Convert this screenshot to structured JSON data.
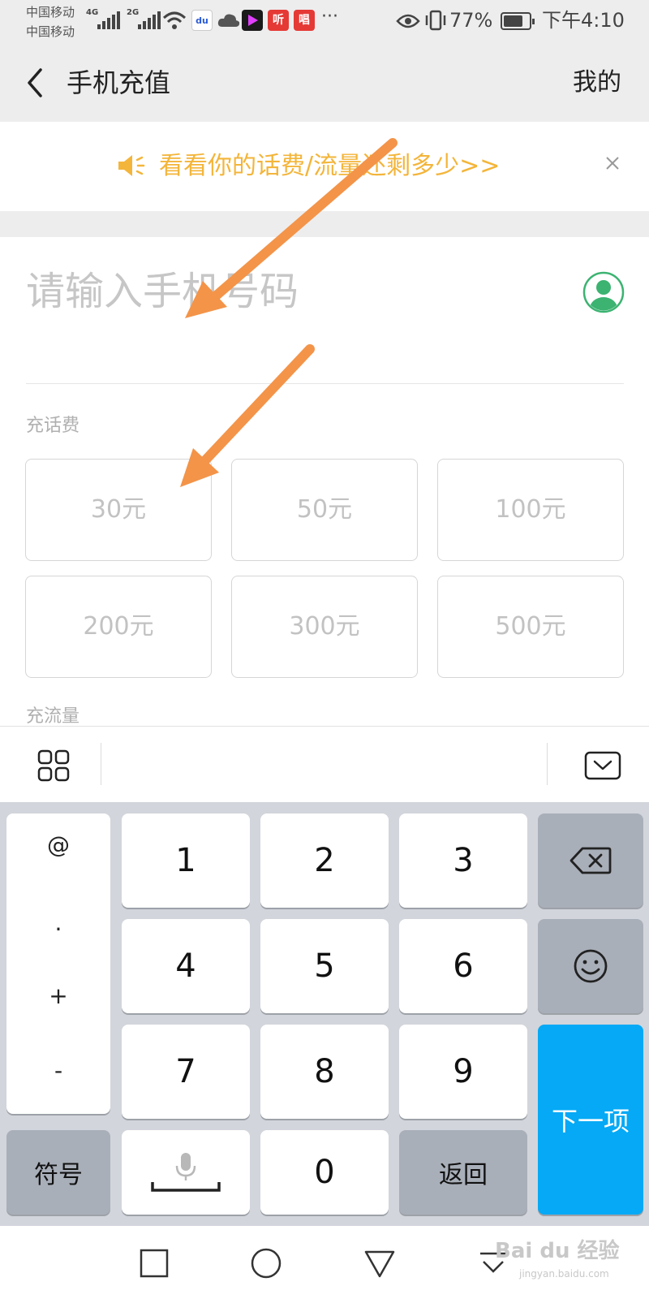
{
  "status_bar": {
    "carrier1": "中国移动",
    "carrier2": "中国移动",
    "net1": "4G",
    "net2": "2G",
    "app_icon_ting": "听",
    "app_icon_chang": "唱",
    "more": "···",
    "battery_percent": "77%",
    "battery_level": 0.77,
    "time": "下午4:10"
  },
  "header": {
    "title": "手机充值",
    "right_link": "我的"
  },
  "banner": {
    "text": "看看你的话费/流量还剩多少>>"
  },
  "phone": {
    "placeholder": "请输入手机号码"
  },
  "sections": {
    "recharge_label": "充话费",
    "data_label": "充流量"
  },
  "amounts": [
    "30元",
    "50元",
    "100元",
    "200元",
    "300元",
    "500元"
  ],
  "keyboard": {
    "symbols": [
      "@",
      ".",
      "+",
      "-"
    ],
    "digits": [
      "1",
      "2",
      "3",
      "4",
      "5",
      "6",
      "7",
      "8",
      "9",
      "0"
    ],
    "symbol_key": "符号",
    "return_key": "返回",
    "next_key": "下一项"
  },
  "colors": {
    "banner_text": "#f3b53a",
    "arrow": "#f39449",
    "next_key": "#05a9f5",
    "contact_icon": "#3cb371"
  },
  "watermark": {
    "main": "Bai du 经验",
    "sub": "jingyan.baidu.com"
  }
}
